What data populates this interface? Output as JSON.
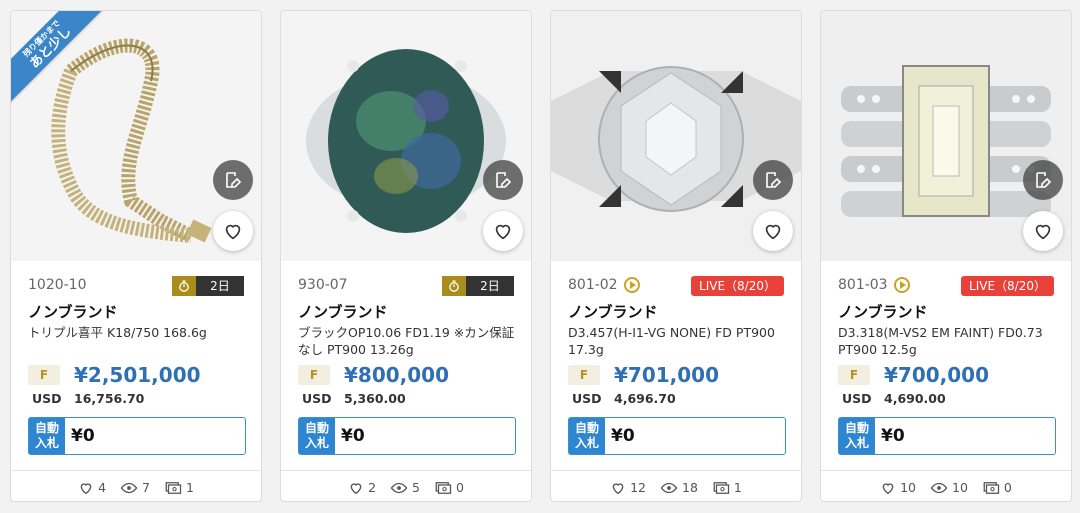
{
  "ribbon": {
    "line1": "残り僅かまで",
    "line2": "あと少し"
  },
  "bid_label": "自動\n入札",
  "usd_label": "USD",
  "cards": [
    {
      "lot": "1020-10",
      "timer": "2日",
      "live": "",
      "brand": "ノンブランド",
      "title": "トリプル喜平 K18/750 168.6g",
      "grade": "F",
      "price": "¥2,501,000",
      "usd": "16,756.70",
      "bid": "¥0",
      "likes": "4",
      "views": "7",
      "bids": "1"
    },
    {
      "lot": "930-07",
      "timer": "2日",
      "live": "",
      "brand": "ノンブランド",
      "title": "ブラックOP10.06 FD1.19 ※カン保証なし PT900 13.26g",
      "grade": "F",
      "price": "¥800,000",
      "usd": "5,360.00",
      "bid": "¥0",
      "likes": "2",
      "views": "5",
      "bids": "0"
    },
    {
      "lot": "801-02",
      "timer": "",
      "live": "LIVE（8/20）",
      "brand": "ノンブランド",
      "title": "D3.457(H-I1-VG NONE) FD PT900 17.3g",
      "grade": "F",
      "price": "¥701,000",
      "usd": "4,696.70",
      "bid": "¥0",
      "likes": "12",
      "views": "18",
      "bids": "1"
    },
    {
      "lot": "801-03",
      "timer": "",
      "live": "LIVE（8/20）",
      "brand": "ノンブランド",
      "title": "D3.318(M-VS2 EM FAINT) FD0.73 PT900 12.5g",
      "grade": "F",
      "price": "¥700,000",
      "usd": "4,690.00",
      "bid": "¥0",
      "likes": "10",
      "views": "10",
      "bids": "0"
    }
  ],
  "colors": {
    "accent": "#2f6fb3",
    "live": "#e8413a",
    "timer_icon": "#a88d1c",
    "ribbon": "#3a86c8"
  }
}
